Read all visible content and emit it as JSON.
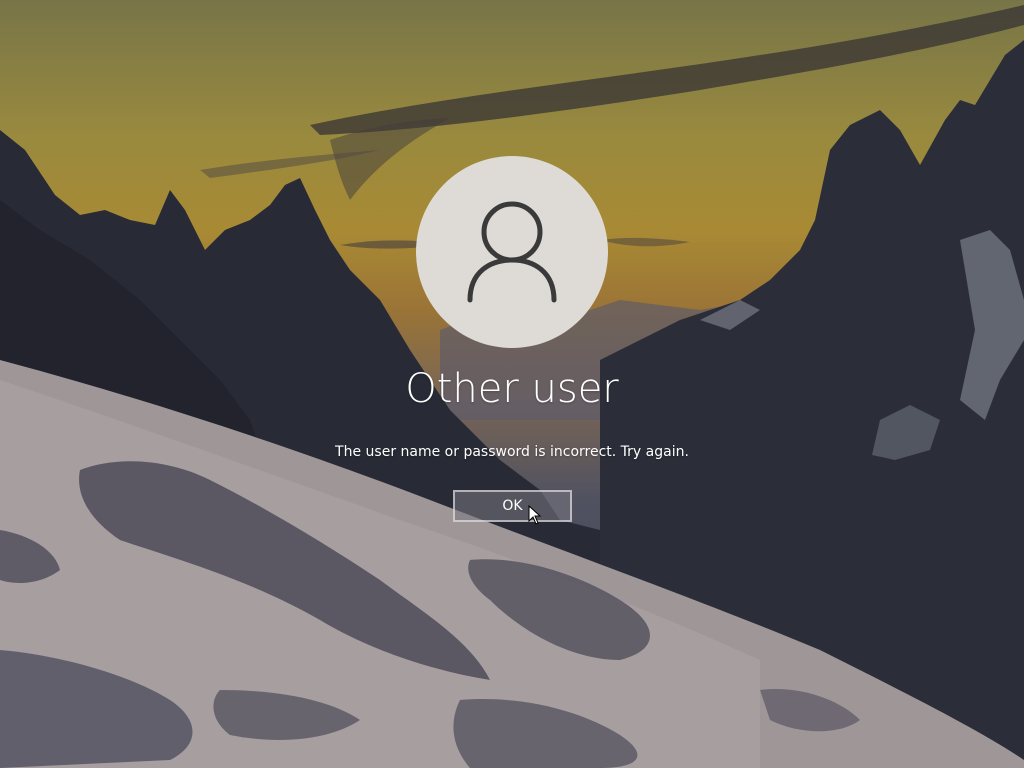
{
  "lock_screen": {
    "user_name": "Other user",
    "message": "The user name or password is incorrect. Try again.",
    "ok_label": "OK"
  },
  "icons": {
    "avatar": "user-silhouette-icon",
    "pointer": "mouse-pointer-icon"
  },
  "colors": {
    "sky_top": "#8d8a52",
    "sky_glow": "#c9a43a",
    "mountain": "#2f3340",
    "snow": "#cfc6c8",
    "avatar_bg": "#dedbd6",
    "avatar_stroke": "#3a3a3a",
    "text": "#ffffff"
  }
}
